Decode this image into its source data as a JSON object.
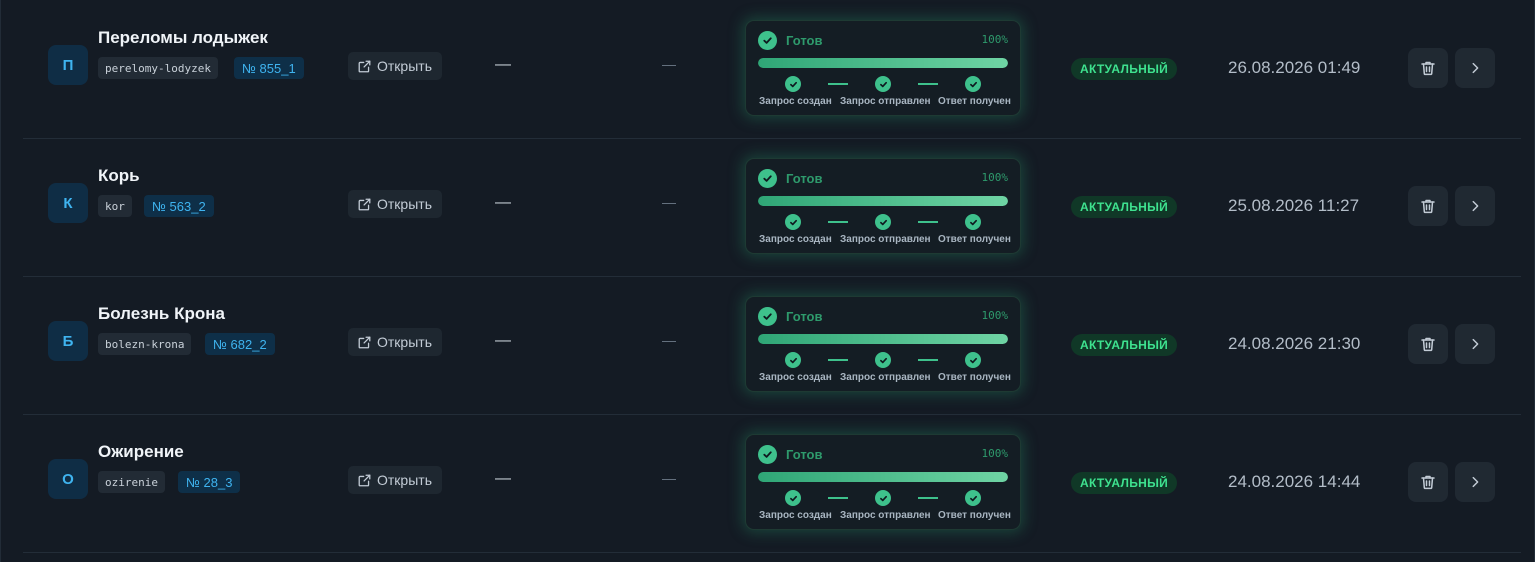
{
  "rows": [
    {
      "avatar": "П",
      "title": "Переломы лодыжек",
      "slug": "perelomy-lodyzek",
      "number": "№ 855_1",
      "open_label": "Открыть",
      "dash_a": "—",
      "dash_b": "—",
      "status": {
        "label": "Готов",
        "percent_text": "100%",
        "progress": 1.0,
        "steps": [
          "Запрос создан",
          "Запрос отправлен",
          "Ответ получен"
        ]
      },
      "badge": "АКТУАЛЬНЫЙ",
      "date": "26.08.2026 01:49"
    },
    {
      "avatar": "К",
      "title": "Корь",
      "slug": "kor",
      "number": "№ 563_2",
      "open_label": "Открыть",
      "dash_a": "—",
      "dash_b": "—",
      "status": {
        "label": "Готов",
        "percent_text": "100%",
        "progress": 1.0,
        "steps": [
          "Запрос создан",
          "Запрос отправлен",
          "Ответ получен"
        ]
      },
      "badge": "АКТУАЛЬНЫЙ",
      "date": "25.08.2026 11:27"
    },
    {
      "avatar": "Б",
      "title": "Болезнь Крона",
      "slug": "bolezn-krona",
      "number": "№ 682_2",
      "open_label": "Открыть",
      "dash_a": "—",
      "dash_b": "—",
      "status": {
        "label": "Готов",
        "percent_text": "100%",
        "progress": 1.0,
        "steps": [
          "Запрос создан",
          "Запрос отправлен",
          "Ответ получен"
        ]
      },
      "badge": "АКТУАЛЬНЫЙ",
      "date": "24.08.2026 21:30"
    },
    {
      "avatar": "О",
      "title": "Ожирение",
      "slug": "ozirenie",
      "number": "№ 28_3",
      "open_label": "Открыть",
      "dash_a": "—",
      "dash_b": "—",
      "status": {
        "label": "Готов",
        "percent_text": "100%",
        "progress": 1.0,
        "steps": [
          "Запрос создан",
          "Запрос отправлен",
          "Ответ получен"
        ]
      },
      "badge": "АКТУАЛЬНЫЙ",
      "date": "24.08.2026 14:44"
    }
  ],
  "icons": {
    "open": "external-link-icon",
    "delete": "trash-icon",
    "details": "chevron-right-icon",
    "check": "check-icon"
  },
  "colors": {
    "background": "#141b24",
    "accent_blue": "#3fb4f0",
    "status_green": "#3ec18c",
    "badge_green": "#3ee28f"
  }
}
